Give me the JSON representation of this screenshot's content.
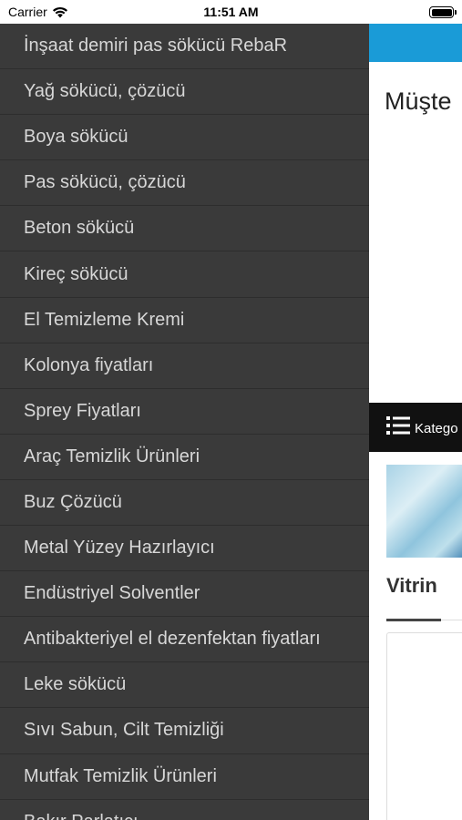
{
  "status_bar": {
    "carrier": "Carrier",
    "time": "11:51 AM",
    "wifi_icon": "wifi-icon",
    "battery_icon": "battery-icon"
  },
  "drawer": {
    "background": "#3a3a3a",
    "items": [
      {
        "label": "İnşaat demiri pas sökücü RebaR"
      },
      {
        "label": "Yağ sökücü, çözücü"
      },
      {
        "label": "Boya sökücü"
      },
      {
        "label": "Pas sökücü, çözücü"
      },
      {
        "label": "Beton sökücü"
      },
      {
        "label": "Kireç sökücü"
      },
      {
        "label": "El Temizleme Kremi"
      },
      {
        "label": "Kolonya fiyatları"
      },
      {
        "label": "Sprey Fiyatları"
      },
      {
        "label": "Araç Temizlik Ürünleri"
      },
      {
        "label": "Buz Çözücü"
      },
      {
        "label": "Metal Yüzey Hazırlayıcı"
      },
      {
        "label": "Endüstriyel Solventler"
      },
      {
        "label": "Antibakteriyel el dezenfektan fiyatları"
      },
      {
        "label": "Leke sökücü"
      },
      {
        "label": "Sıvı Sabun, Cilt Temizliği"
      },
      {
        "label": "Mutfak Temizlik Ürünleri"
      },
      {
        "label": "Bakır Parlatıcı"
      }
    ]
  },
  "main": {
    "accent_color": "#1a9bd7",
    "heading": "Müşte",
    "category_bar": {
      "icon": "list-icon",
      "label": "Katego"
    },
    "section_title": "Vitrin"
  }
}
